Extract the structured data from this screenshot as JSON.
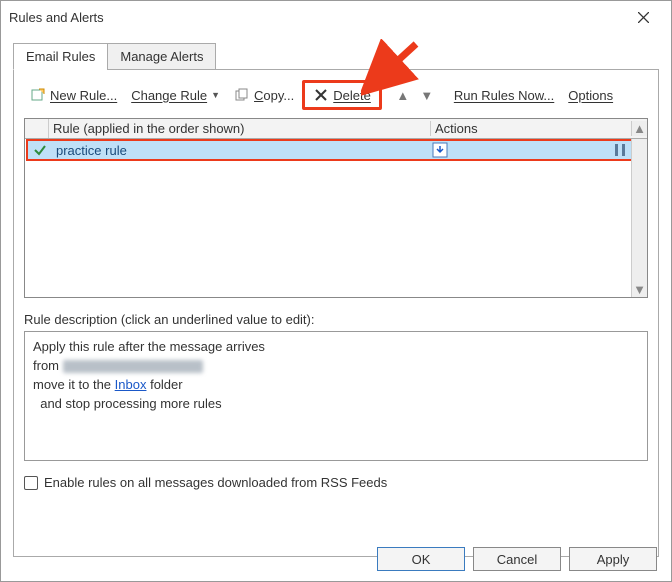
{
  "dialog": {
    "title": "Rules and Alerts"
  },
  "tabs": {
    "email_rules": "Email Rules",
    "manage_alerts": "Manage Alerts"
  },
  "toolbar": {
    "new_rule": "New Rule...",
    "change_rule": "Change Rule",
    "copy": "Copy...",
    "delete": "Delete",
    "run_now": "Run Rules Now...",
    "options": "Options"
  },
  "grid": {
    "col_rule": "Rule (applied in the order shown)",
    "col_actions": "Actions",
    "rows": [
      {
        "name": "practice rule",
        "checked": true
      }
    ]
  },
  "description": {
    "label": "Rule description (click an underlined value to edit):",
    "line1": "Apply this rule after the message arrives",
    "line2_prefix": "from ",
    "line3_prefix": "move it to the ",
    "line3_link": "Inbox",
    "line3_suffix": " folder",
    "line4": "  and stop processing more rules"
  },
  "rss": {
    "label": "Enable rules on all messages downloaded from RSS Feeds"
  },
  "footer": {
    "ok": "OK",
    "cancel": "Cancel",
    "apply": "Apply"
  }
}
